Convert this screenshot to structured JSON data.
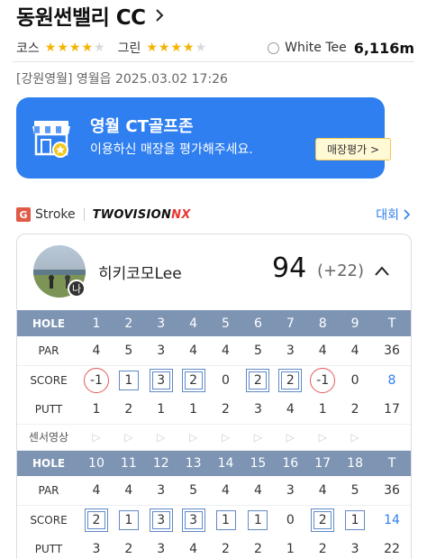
{
  "header": {
    "course_name": "동원썬밸리 CC"
  },
  "ratings": {
    "course_label": "코스",
    "course_stars": 4,
    "green_label": "그린",
    "green_stars": 4,
    "max_stars": 5,
    "tee_name": "White Tee",
    "tee_distance": "6,116m"
  },
  "round_meta": "[강원영월] 영월읍 2025.03.02 17:26",
  "banner": {
    "title": "영월 CT골프존",
    "subtitle": "이용하신 매장을 평가해주세요.",
    "button_label": "매장평가 >"
  },
  "source": {
    "badge": "G",
    "mode": "Stroke",
    "brand_main": "TWOVISION",
    "brand_accent": "NX",
    "compete_label": "대회"
  },
  "player": {
    "avatar_badge": "나",
    "name": "히키코모Lee",
    "total": "94",
    "diff": "(+22)"
  },
  "table": {
    "labels": {
      "hole": "HOLE",
      "par": "PAR",
      "score": "SCORE",
      "putt": "PUTT",
      "video": "센서영상",
      "total": "T"
    },
    "front": {
      "holes": [
        "1",
        "2",
        "3",
        "4",
        "5",
        "6",
        "7",
        "8",
        "9"
      ],
      "par": [
        "4",
        "5",
        "3",
        "4",
        "4",
        "5",
        "3",
        "4",
        "4"
      ],
      "par_total": "36",
      "score": [
        "-1",
        "1",
        "3",
        "2",
        "0",
        "2",
        "2",
        "-1",
        "0"
      ],
      "score_total": "8",
      "putt": [
        "1",
        "2",
        "1",
        "1",
        "2",
        "3",
        "4",
        "1",
        "2"
      ],
      "putt_total": "17"
    },
    "back": {
      "holes": [
        "10",
        "11",
        "12",
        "13",
        "14",
        "15",
        "16",
        "17",
        "18"
      ],
      "par": [
        "4",
        "4",
        "3",
        "5",
        "4",
        "4",
        "3",
        "4",
        "5"
      ],
      "par_total": "36",
      "score": [
        "2",
        "1",
        "3",
        "3",
        "1",
        "1",
        "0",
        "2",
        "1"
      ],
      "score_total": "14",
      "putt": [
        "3",
        "2",
        "3",
        "4",
        "2",
        "2",
        "1",
        "2",
        "3"
      ],
      "putt_total": "22"
    }
  },
  "colors": {
    "accent": "#2f7ff0",
    "hole_header": "#7d94b3",
    "star_on": "#f5b301",
    "birdie": "#e25a5a",
    "bogey": "#5f89c6"
  }
}
